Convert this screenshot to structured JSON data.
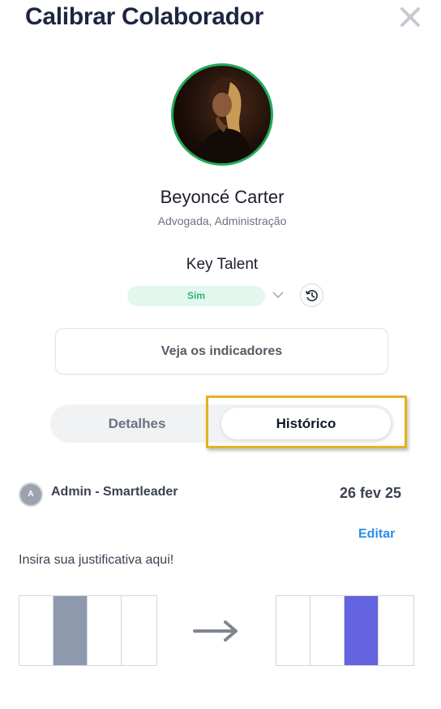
{
  "modal": {
    "title": "Calibrar Colaborador",
    "close_icon": "close-icon"
  },
  "profile": {
    "name": "Beyoncé Carter",
    "role": "Advogada, Administração",
    "avatar_border_color": "#22a95a"
  },
  "key_talent": {
    "label": "Key Talent",
    "value": "Sim",
    "chevron_icon": "chevron-down-icon",
    "history_icon": "history-icon"
  },
  "indicators_button": "Veja os indicadores",
  "tabs": {
    "details": "Detalhes",
    "history": "Histórico",
    "active": "history"
  },
  "history_entry": {
    "avatar_initial": "A",
    "author": "Admin - Smartleader",
    "date": "26 fev 25",
    "edit_label": "Editar",
    "justification": "Insira sua justificativa aqui!",
    "before": {
      "selected_index": 1,
      "color": "#8e99ae"
    },
    "after": {
      "selected_index": 2,
      "color": "#6463e0"
    },
    "arrow_icon": "arrow-right-icon"
  },
  "colors": {
    "accent_blue": "#2b8ee8",
    "pill_green_text": "#2bb673",
    "pill_green_bg": "#e3f7ee",
    "highlight": "#e5b21c"
  }
}
